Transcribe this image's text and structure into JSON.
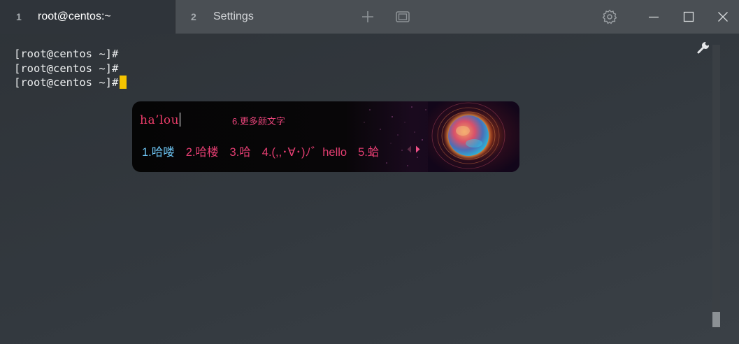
{
  "tabs": [
    {
      "number": "1",
      "label": "root@centos:~"
    },
    {
      "number": "2",
      "label": "Settings"
    }
  ],
  "titlebar_icons": [
    "plus-icon",
    "new-window-icon",
    "gear-icon",
    "minimize-icon",
    "maximize-icon",
    "close-icon"
  ],
  "terminal": {
    "lines": [
      "[root@centos ~]#",
      "[root@centos ~]#",
      "[root@centos ~]#"
    ],
    "cursor_color": "#f5c400"
  },
  "ime": {
    "input": "ha’lou",
    "more_label": "6.更多颜文字",
    "candidates": [
      "1.哈喽",
      "2.哈楼",
      "3.哈",
      "4.(,,･∀･)ﾉ゛hello",
      "5.蛤"
    ],
    "highlight_color": "#6ec6f5",
    "candidate_color": "#e53e72"
  },
  "colors": {
    "titlebar": "#4a4f54",
    "terminal_bg": "#2f343a",
    "text": "#eef0f1"
  }
}
